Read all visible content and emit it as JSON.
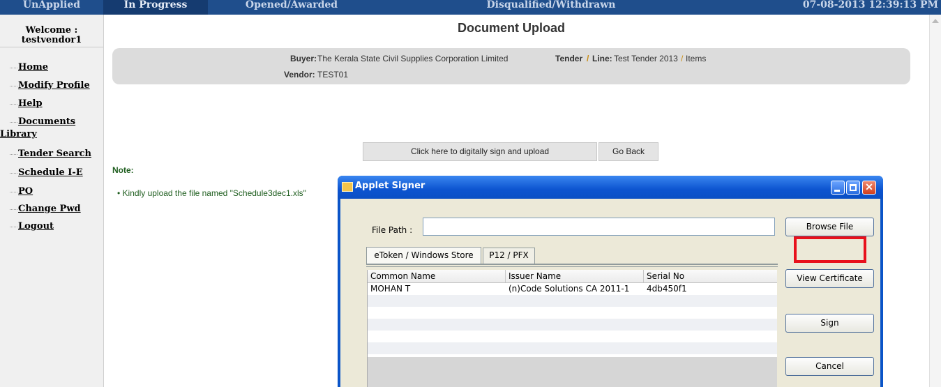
{
  "topbar": {
    "tabs": [
      "UnApplied",
      "In Progress",
      "Opened/Awarded",
      "Disqualified/Withdrawn"
    ],
    "datetime": "07-08-2013 12:39:13 PM"
  },
  "sidebar": {
    "welcome": "Welcome :",
    "username": "testvendor1",
    "menu": [
      "Home",
      "Modify Profile",
      "Help",
      "Documents",
      "Library",
      "Tender Search",
      "Schedule I-E",
      "PO",
      "Change Pwd",
      "Logout"
    ]
  },
  "page": {
    "title": "Document Upload",
    "buyer_label": "Buyer:",
    "buyer_value": "The Kerala State Civil Supplies Corporation Limited",
    "tender_label": "Tender",
    "line_label": "Line:",
    "tender_value": "Test Tender 2013",
    "line_value": "Items",
    "slash": "/",
    "vendor_label": "Vendor:",
    "vendor_value": "TEST01",
    "sign_upload_button": "Click here to digitally sign and upload",
    "go_back_button": "Go Back",
    "note_label": "Note:",
    "note_item": "Kindly upload the file named \"Schedule3dec1.xls\""
  },
  "applet": {
    "title": "Applet Signer",
    "file_path_label": "File Path :",
    "file_path_value": "",
    "browse_button": "Browse File",
    "view_cert_button": "View Certificate",
    "sign_button": "Sign",
    "cancel_button": "Cancel",
    "tabs": [
      "eToken / Windows Store",
      "P12 / PFX"
    ],
    "columns": [
      "Common Name",
      "Issuer Name",
      "Serial No"
    ],
    "rows": [
      [
        "MOHAN T",
        "(n)Code Solutions CA 2011-1",
        "4db450f1"
      ]
    ]
  },
  "colors": {
    "topbar_bg": "#1f4e8c",
    "note_green": "#1f5e1f",
    "highlight_red": "#e8111c",
    "window_blue": "#0a54c8"
  }
}
